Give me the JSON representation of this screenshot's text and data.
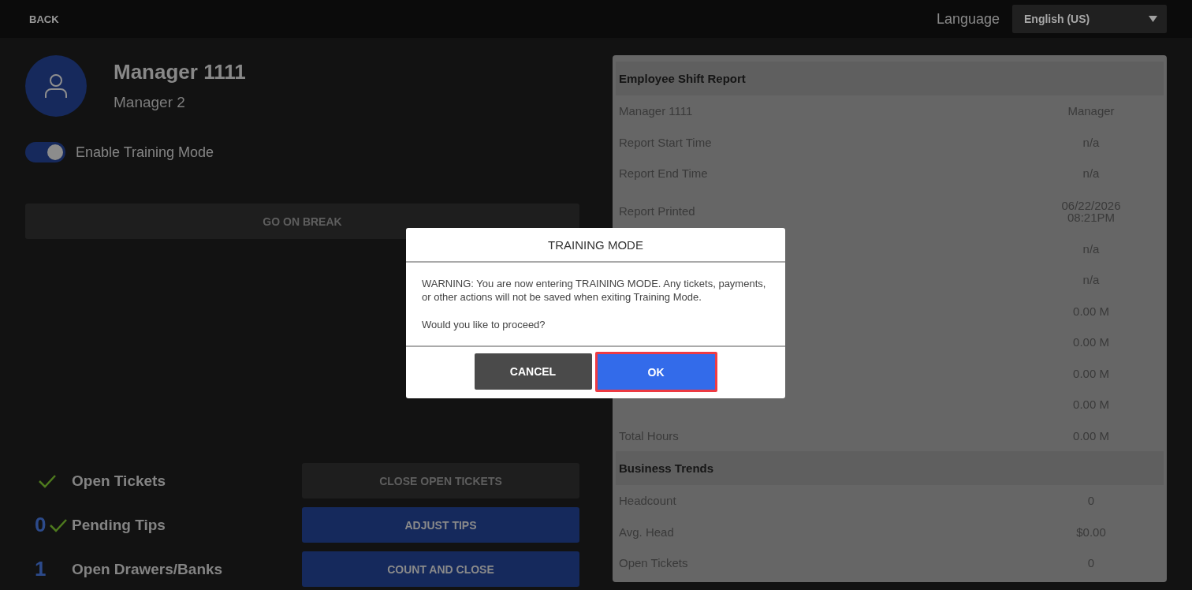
{
  "top_bar": {
    "back": "BACK",
    "language_label": "Language",
    "language_value": "English (US)"
  },
  "profile": {
    "name": "Manager 1111",
    "role": "Manager 2"
  },
  "training_toggle": {
    "label": "Enable Training Mode",
    "on": true
  },
  "break_button": {
    "label": "GO ON BREAK",
    "disabled": true
  },
  "checklist": [
    {
      "label": "Open Tickets",
      "done": true,
      "button": "CLOSE OPEN TICKETS",
      "disabled": true
    },
    {
      "label": "Pending Tips",
      "done": true,
      "count": "0",
      "button": "ADJUST TIPS",
      "disabled": false
    },
    {
      "label": "Open Drawers/Banks",
      "done": false,
      "count": "1",
      "button": "COUNT AND CLOSE",
      "disabled": false
    }
  ],
  "report": [
    {
      "kind": "header",
      "label": "Employee Shift Report"
    },
    {
      "kind": "row",
      "label": "Manager 1111",
      "value": "Manager"
    },
    {
      "kind": "row",
      "label": "Report Start Time",
      "value": "n/a"
    },
    {
      "kind": "row",
      "label": "Report End Time",
      "value": "n/a"
    },
    {
      "kind": "tall",
      "label": "Report Printed",
      "value": "06/22/2026",
      "value_2": "08:21PM"
    },
    {
      "kind": "row",
      "value": "n/a"
    },
    {
      "kind": "row",
      "value": "n/a"
    },
    {
      "kind": "row",
      "value": "0.00 M"
    },
    {
      "kind": "row",
      "value": "0.00 M"
    },
    {
      "kind": "row",
      "value": "0.00 M"
    },
    {
      "kind": "row",
      "value": "0.00 M"
    },
    {
      "kind": "row",
      "label": "Total Hours",
      "value": "0.00 M"
    },
    {
      "kind": "header",
      "label": "Business Trends"
    },
    {
      "kind": "row",
      "label": "Headcount",
      "value": "0"
    },
    {
      "kind": "row",
      "label": "Avg. Head",
      "value": "$0.00"
    },
    {
      "kind": "row",
      "label": "Open Tickets",
      "value": "0"
    }
  ],
  "dialog": {
    "title": "TRAINING MODE",
    "message": "WARNING: You are now entering TRAINING MODE. Any tickets, payments, or other actions will not be saved when exiting Training Mode.",
    "question": "Would you like to proceed?",
    "buttons": [
      {
        "label": "CANCEL",
        "kind": "secondary",
        "highlighted": false
      },
      {
        "label": "OK",
        "kind": "primary",
        "highlighted": true
      }
    ]
  }
}
